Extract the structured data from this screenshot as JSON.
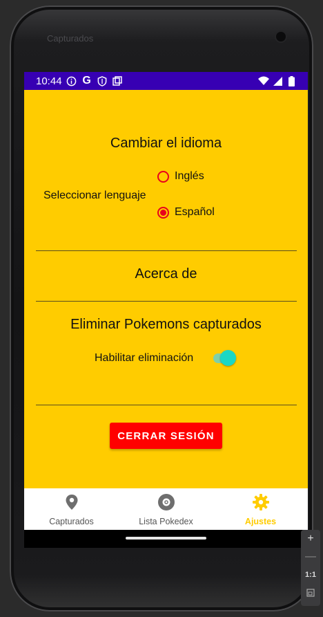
{
  "status_bar": {
    "time": "10:44",
    "icons": [
      "info-icon",
      "google-icon",
      "shield-icon",
      "clipboard-icon",
      "wifi-icon",
      "signal-icon",
      "battery-icon"
    ],
    "color": "#3700b3"
  },
  "settings": {
    "language_title": "Cambiar el idioma",
    "language_label": "Seleccionar lenguaje",
    "options": [
      {
        "label": "Inglés",
        "selected": false
      },
      {
        "label": "Español",
        "selected": true
      }
    ],
    "about_title": "Acerca de",
    "delete_title": "Eliminar Pokemons capturados",
    "delete_toggle_label": "Habilitar eliminación",
    "delete_toggle_on": true,
    "logout_label": "CERRAR SESIÓN"
  },
  "bottom_nav": {
    "items": [
      {
        "label": "Capturados",
        "icon": "location-pin-icon",
        "active": false
      },
      {
        "label": "Lista Pokedex",
        "icon": "pokeball-icon",
        "active": false
      },
      {
        "label": "Ajustes",
        "icon": "gear-icon",
        "active": true
      }
    ]
  },
  "emulator_toolbar": {
    "zoom_in": "+",
    "zoom_out": "—",
    "one_to_one": "1:1"
  },
  "colors": {
    "background": "#ffcc00",
    "accent": "#e8001c",
    "logout_button": "#ff0000",
    "toggle_thumb": "#1dd7c4"
  }
}
